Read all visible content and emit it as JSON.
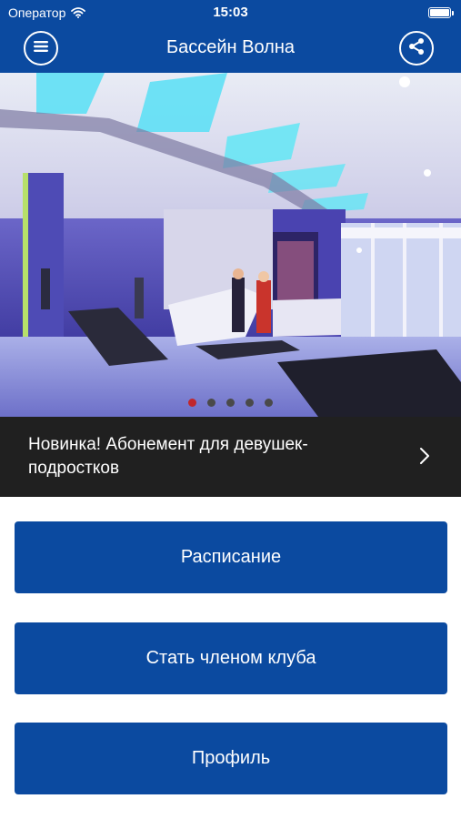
{
  "status_bar": {
    "carrier": "Оператор",
    "time": "15:03",
    "wifi_icon": "wifi-icon",
    "battery_level": 1.0
  },
  "nav": {
    "title": "Бассейн Волна",
    "menu_icon": "hamburger-menu-icon",
    "share_icon": "share-icon"
  },
  "carousel": {
    "image_description_icon": "pool-lobby-photo",
    "slide_count": 5,
    "active_index": 0,
    "caption": "Новинка! Абонемент для девушек-подростков",
    "caption_chevron_icon": "chevron-right-icon"
  },
  "buttons": {
    "schedule": "Расписание",
    "join_club": "Стать членом клуба",
    "profile": "Профиль"
  },
  "colors": {
    "brand_blue": "#0b4aa0",
    "dark_bar": "#202020",
    "dot_active": "#c0272d",
    "dot_inactive": "#4a4a4a"
  }
}
